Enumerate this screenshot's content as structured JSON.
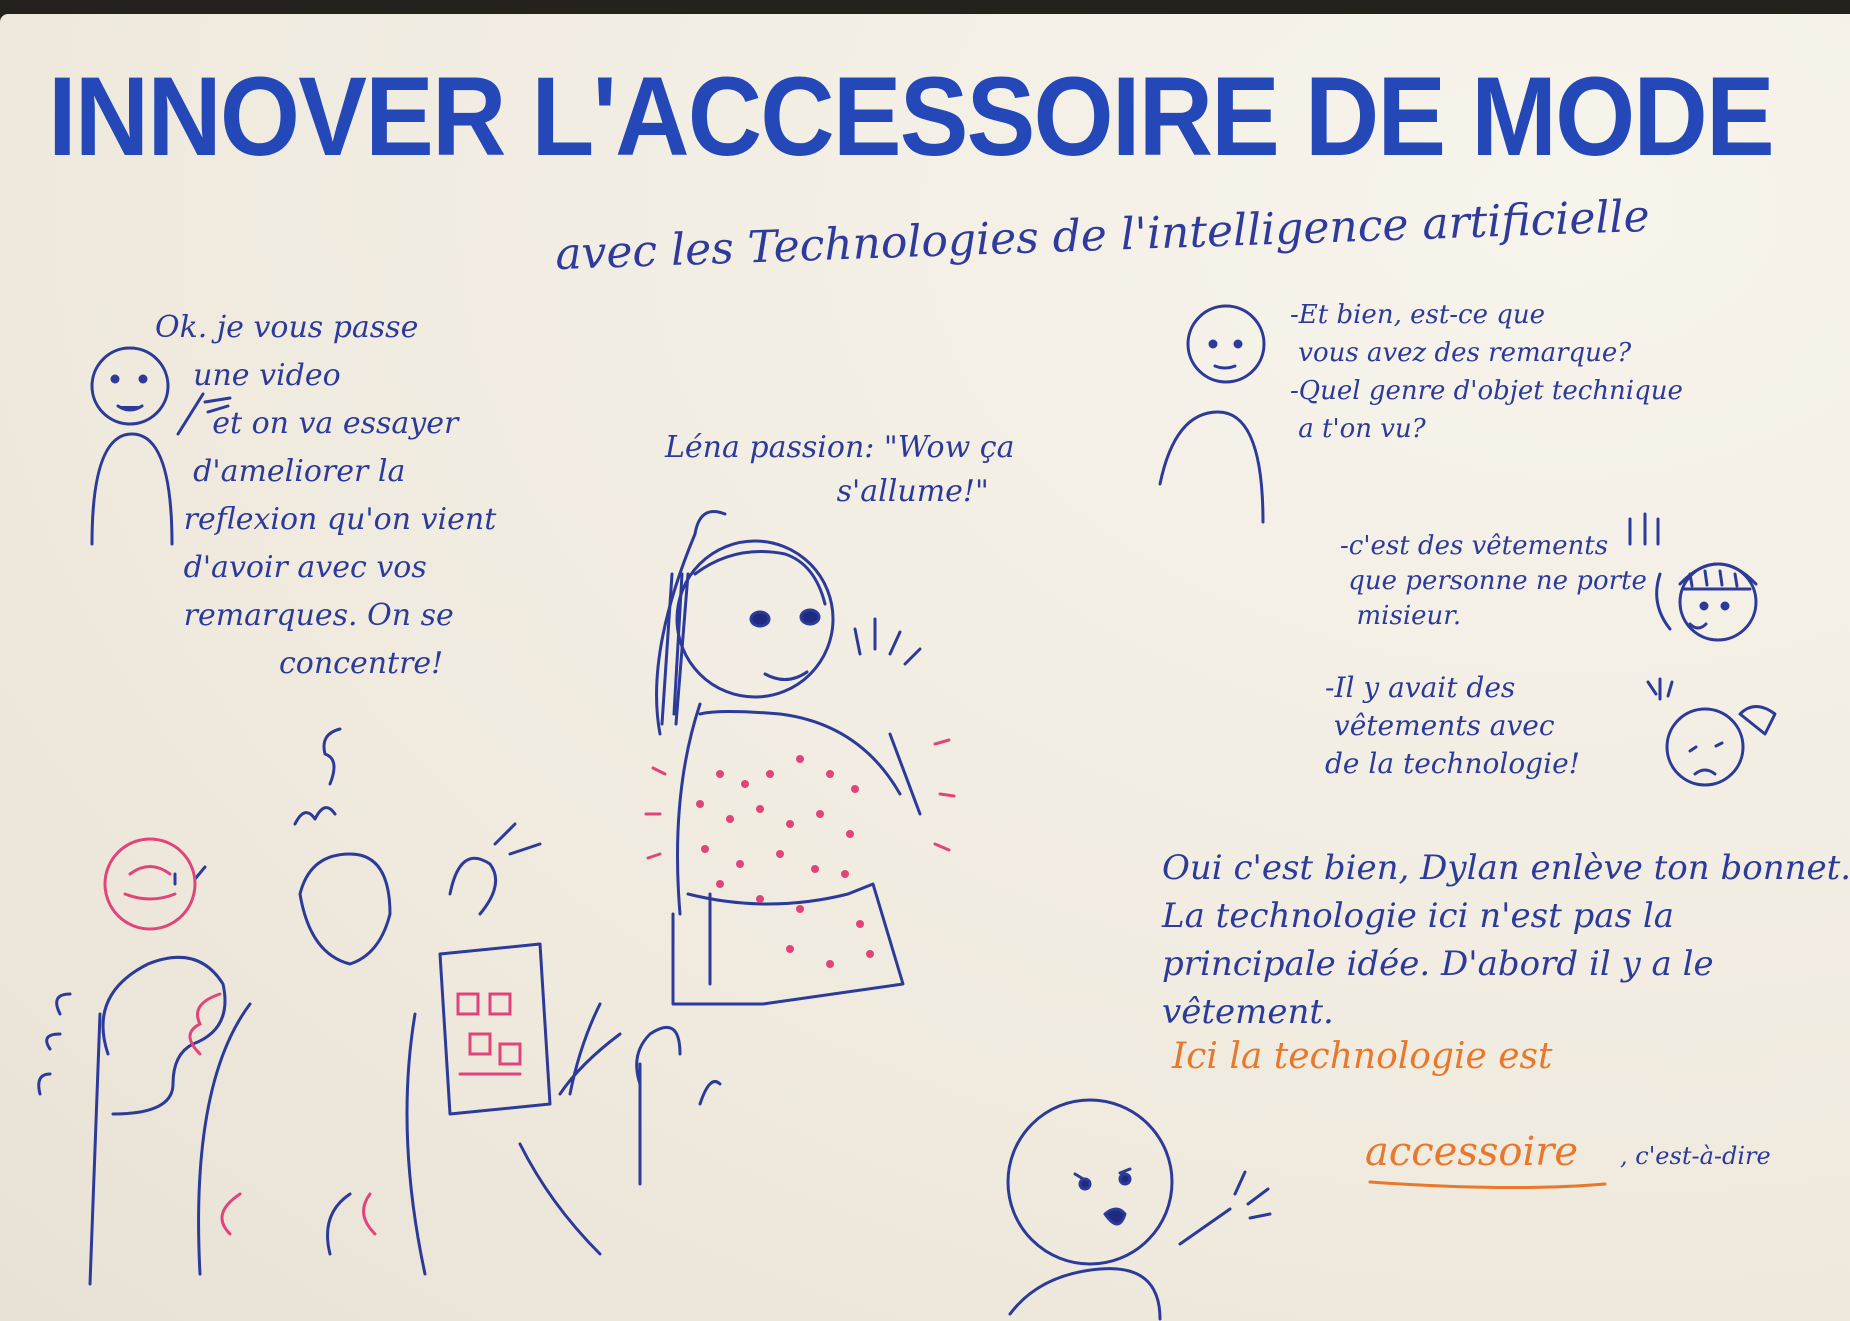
{
  "title": "INNOVER L'ACCESSOIRE DE MODE",
  "subtitle": "avec les Technologies de l'intelligence artificielle",
  "speech_teacher": "Ok. je vous passe\n    une video\n      et on va essayer\n    d'ameliorer la\n   reflexion qu'on vient\n   d'avoir avec vos\n   remarques. On se\n             concentre!",
  "speech_lena": "Léna passion: \"Wow ça\n                  s'allume!\"",
  "speech_questions": "-Et bien, est-ce que\n vous avez des remarque?\n-Quel genre d'objet technique\n a t'on vu?",
  "speech_answer1": "-c'est des vêtements\n que personne ne porte\n  misieur.",
  "speech_answer2": "-Il y avait des\n vêtements avec\nde la technologie!",
  "speech_conclusion": "Oui c'est bien, Dylan enlève ton bonnet.\nLa technologie ici n'est pas la\nprincipale idée. D'abord il y a le\nvêtement.",
  "highlight_line": "Ici la technologie est",
  "highlight_word": "accessoire",
  "highlight_tail": ", c'est-à-dire",
  "colors": {
    "marker_blue": "#2448b8",
    "pen_blue": "#2c3a9a",
    "orange": "#e8782b",
    "pink": "#e0457a",
    "paper": "#f3efe6"
  }
}
